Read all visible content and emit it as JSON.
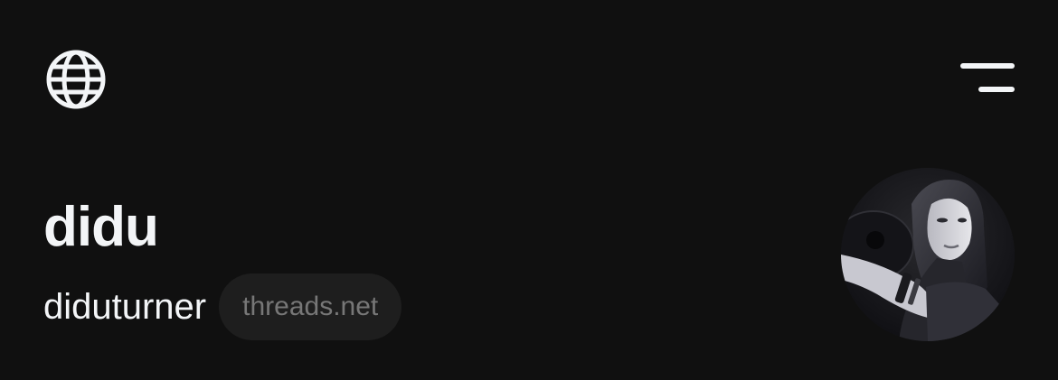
{
  "header": {
    "left_icon": "globe-icon",
    "right_icon": "menu-icon"
  },
  "profile": {
    "name": "didu",
    "username": "diduturner",
    "domain_badge": "threads.net",
    "avatar": "profile-photo"
  },
  "colors": {
    "background": "#101010",
    "text_primary": "#f3f5f7",
    "pill_background": "#1e1e1e",
    "pill_text": "#777777"
  }
}
